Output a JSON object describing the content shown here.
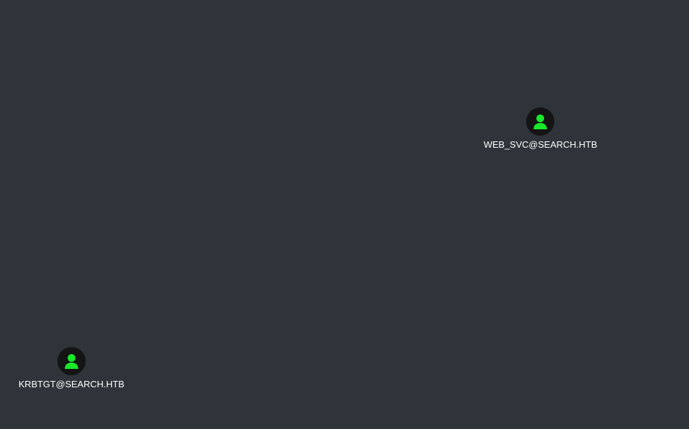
{
  "graph": {
    "nodes": [
      {
        "id": "web_svc",
        "label": "WEB_SVC@SEARCH.HTB",
        "type": "user",
        "icon": "user-icon",
        "icon_color": "#17e82a"
      },
      {
        "id": "krbtgt",
        "label": "KRBTGT@SEARCH.HTB",
        "type": "user",
        "icon": "user-icon",
        "icon_color": "#17e82a"
      }
    ]
  },
  "colors": {
    "background": "#2f343b",
    "node_bg": "#141414",
    "user_icon": "#17e82a",
    "label_text": "#ffffff"
  }
}
